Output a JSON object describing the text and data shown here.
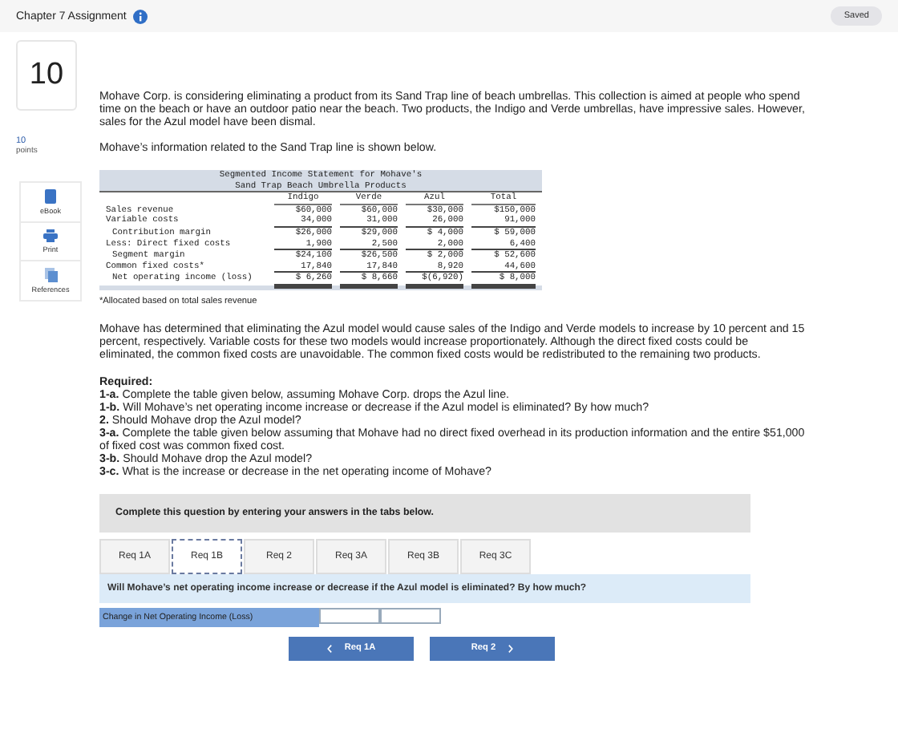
{
  "header": {
    "title": "Chapter 7 Assignment",
    "status": "Saved"
  },
  "question": {
    "number": "10",
    "points": "10",
    "points_label": "points"
  },
  "tools": [
    {
      "kind": "ebook",
      "label": "eBook"
    },
    {
      "kind": "print",
      "label": "Print"
    },
    {
      "kind": "references",
      "label": "References"
    }
  ],
  "intro": "Mohave Corp. is considering eliminating a product from its Sand Trap line of beach umbrellas. This collection is aimed at people who spend time on the beach or have an outdoor patio near the beach. Two products, the Indigo and Verde umbrellas, have impressive sales. However, sales for the Azul model have been dismal.",
  "lead": "Mohave’s information related to the Sand Trap line is shown below.",
  "statement": {
    "title": [
      "Segmented Income Statement for Mohave's",
      "Sand Trap Beach Umbrella Products"
    ],
    "columns": [
      "Indigo",
      "Verde",
      "Azul",
      "Total"
    ],
    "rows": [
      {
        "label": "Sales revenue",
        "kind": "line",
        "underlined": false,
        "double_underlined": false,
        "values": [
          "$60,000",
          "$60,000",
          "$30,000",
          "$150,000"
        ]
      },
      {
        "label": "Variable costs",
        "kind": "line",
        "underlined": true,
        "double_underlined": false,
        "values": [
          "34,000",
          "31,000",
          "26,000",
          "91,000"
        ]
      },
      {
        "label": "Contribution margin",
        "kind": "subtotal",
        "underlined": false,
        "double_underlined": false,
        "values": [
          "$26,000",
          "$29,000",
          "$ 4,000",
          "$ 59,000"
        ]
      },
      {
        "label": "Less: Direct fixed costs",
        "kind": "line",
        "underlined": true,
        "double_underlined": false,
        "values": [
          "1,900",
          "2,500",
          "2,000",
          "6,400"
        ]
      },
      {
        "label": "Segment margin",
        "kind": "subtotal",
        "underlined": false,
        "double_underlined": false,
        "values": [
          "$24,100",
          "$26,500",
          "$ 2,000",
          "$ 52,600"
        ]
      },
      {
        "label": "Common fixed costs*",
        "kind": "line",
        "underlined": true,
        "double_underlined": false,
        "values": [
          "17,840",
          "17,840",
          "8,920",
          "44,600"
        ]
      },
      {
        "label": "Net operating income (loss)",
        "kind": "subtotal",
        "underlined": true,
        "double_underlined": true,
        "values": [
          "$ 6,260",
          "$ 8,660",
          "$(6,920)",
          "$  8,000"
        ]
      }
    ]
  },
  "footnote": "*Allocated based on total sales revenue",
  "scenario": "Mohave has determined that eliminating the Azul model would cause sales of the Indigo and Verde models to increase by 10 percent and 15 percent, respectively. Variable costs for these two models would increase proportionately. Although the direct fixed costs could be eliminated, the common fixed costs are unavoidable. The common fixed costs would be redistributed to the remaining two products.",
  "required_heading": "Required:",
  "requirements": [
    "**1-a.** Complete the table given below, assuming Mohave Corp. drops the Azul line.",
    "**1-b.** Will Mohave’s net operating income increase or decrease if the Azul model is eliminated? By how much?",
    "**2.** Should Mohave drop the Azul model?",
    "**3-a.** Complete the table given below assuming that Mohave had no direct fixed overhead in its production information and the entire $51,000 of fixed cost was common fixed cost.",
    "**3-b.** Should Mohave drop the Azul model?",
    "**3-c.** What is the increase or decrease in the net operating income of Mohave?"
  ],
  "instructions": "Complete this question by entering your answers in the tabs below.",
  "tabs": [
    {
      "label": "Req 1A",
      "selected": false
    },
    {
      "label": "Req 1B",
      "selected": true
    },
    {
      "label": "Req 2",
      "selected": false
    },
    {
      "label": "Req 3A",
      "selected": false
    },
    {
      "label": "Req 3B",
      "selected": false
    },
    {
      "label": "Req 3C",
      "selected": false
    }
  ],
  "prompt": "Will Mohave’s net operating income increase or decrease if the Azul model is eliminated? By how much?",
  "answer_row": {
    "label": "Change in Net Operating Income (Loss)",
    "fields": [
      {
        "kind": "input"
      },
      {
        "kind": "input"
      }
    ]
  },
  "nav": [
    {
      "kind": "prev",
      "label": "Req 1A"
    },
    {
      "kind": "next",
      "label": "Req 2"
    }
  ]
}
